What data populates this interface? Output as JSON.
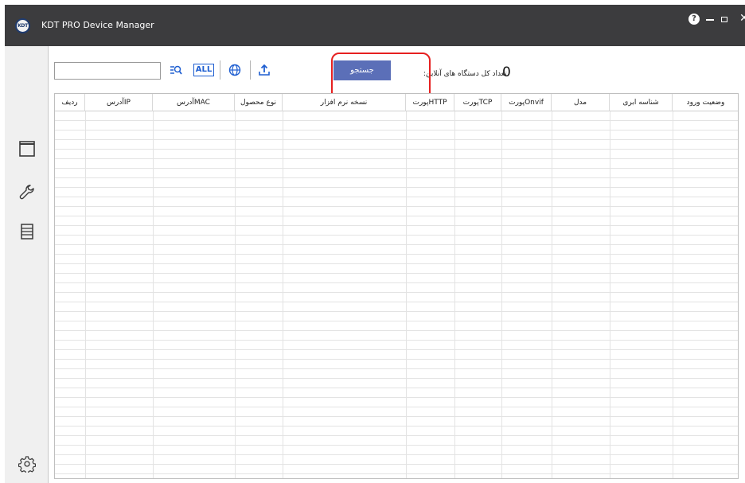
{
  "app": {
    "title": "KDT PRO Device Manager",
    "logo_text": "KDT"
  },
  "window_controls": {
    "help": "?",
    "close": "✕"
  },
  "toolbar": {
    "search_value": "",
    "all_label": "ALL",
    "search_button": "جستجو",
    "online_count_label": "تعداد کل دستگاه های آنلاین:",
    "online_count": "0"
  },
  "table": {
    "columns": [
      "ردیف",
      "آدرسIP",
      "آدرسMAC",
      "نوع محصول",
      "نسخه نرم افزار",
      "پورتHTTP",
      "پورتTCP",
      "پورتOnvif",
      "مدل",
      "شناسه ابری",
      "وضعیت ورود"
    ],
    "rows": []
  },
  "sidebar": {
    "items": [
      "window-icon",
      "wrench-icon",
      "list-icon"
    ],
    "bottom": "settings-icon"
  },
  "colors": {
    "titlebar": "#3c3c3e",
    "accent": "#5b6fb8",
    "icon_blue": "#1f5fd1",
    "highlight": "#e62020"
  }
}
